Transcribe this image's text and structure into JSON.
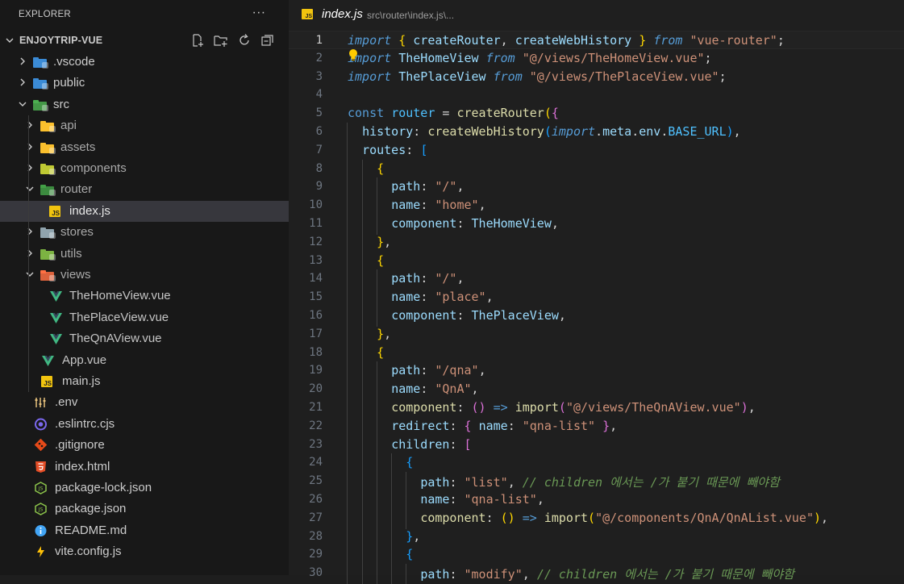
{
  "explorer": {
    "title": "EXPLORER",
    "more_label": "···",
    "project_name": "ENJOYTRIP-VUE",
    "actions": [
      "new-file-icon",
      "new-folder-icon",
      "refresh-icon",
      "collapse-all-icon"
    ],
    "items": [
      {
        "label": ".vscode",
        "kind": "folder",
        "depth": 1,
        "expanded": false,
        "icon": "vscode-folder-icon",
        "color": "#3b8bd6"
      },
      {
        "label": "public",
        "kind": "folder",
        "depth": 1,
        "expanded": false,
        "icon": "public-folder-icon",
        "color": "#3b8bd6"
      },
      {
        "label": "src",
        "kind": "folder",
        "depth": 1,
        "expanded": true,
        "icon": "src-folder-icon",
        "color": "#4caf50"
      },
      {
        "label": "api",
        "kind": "folder",
        "depth": 2,
        "expanded": false,
        "icon": "api-folder-icon",
        "color": "#fbc02d"
      },
      {
        "label": "assets",
        "kind": "folder",
        "depth": 2,
        "expanded": false,
        "icon": "assets-folder-icon",
        "color": "#fbc02d"
      },
      {
        "label": "components",
        "kind": "folder",
        "depth": 2,
        "expanded": false,
        "icon": "components-folder-icon",
        "color": "#c0ca33"
      },
      {
        "label": "router",
        "kind": "folder",
        "depth": 2,
        "expanded": true,
        "icon": "router-folder-icon",
        "color": "#43a047"
      },
      {
        "label": "index.js",
        "kind": "file",
        "depth": 3,
        "icon": "js-file-icon",
        "selected": true
      },
      {
        "label": "stores",
        "kind": "folder",
        "depth": 2,
        "expanded": false,
        "icon": "stores-folder-icon",
        "color": "#90a4ae"
      },
      {
        "label": "utils",
        "kind": "folder",
        "depth": 2,
        "expanded": false,
        "icon": "utils-folder-icon",
        "color": "#7cb342"
      },
      {
        "label": "views",
        "kind": "folder",
        "depth": 2,
        "expanded": true,
        "icon": "views-folder-icon",
        "color": "#ff7043"
      },
      {
        "label": "TheHomeView.vue",
        "kind": "file",
        "depth": 3,
        "icon": "vue-file-icon"
      },
      {
        "label": "ThePlaceView.vue",
        "kind": "file",
        "depth": 3,
        "icon": "vue-file-icon"
      },
      {
        "label": "TheQnAView.vue",
        "kind": "file",
        "depth": 3,
        "icon": "vue-file-icon"
      },
      {
        "label": "App.vue",
        "kind": "file",
        "depth": 2,
        "icon": "vue-file-icon"
      },
      {
        "label": "main.js",
        "kind": "file",
        "depth": 2,
        "icon": "js-file-icon"
      },
      {
        "label": ".env",
        "kind": "file",
        "depth": 1,
        "icon": "env-file-icon"
      },
      {
        "label": ".eslintrc.cjs",
        "kind": "file",
        "depth": 1,
        "icon": "eslint-file-icon"
      },
      {
        "label": ".gitignore",
        "kind": "file",
        "depth": 1,
        "icon": "git-file-icon"
      },
      {
        "label": "index.html",
        "kind": "file",
        "depth": 1,
        "icon": "html-file-icon"
      },
      {
        "label": "package-lock.json",
        "kind": "file",
        "depth": 1,
        "icon": "nodejs-file-icon"
      },
      {
        "label": "package.json",
        "kind": "file",
        "depth": 1,
        "icon": "nodejs-file-icon"
      },
      {
        "label": "README.md",
        "kind": "file",
        "depth": 1,
        "icon": "info-file-icon"
      },
      {
        "label": "vite.config.js",
        "kind": "file",
        "depth": 1,
        "icon": "vite-file-icon"
      }
    ]
  },
  "editor": {
    "file_name": "index.js",
    "file_badge": "JS",
    "file_path": "src\\router\\index.js\\...",
    "current_line": 1,
    "lines": [
      {
        "n": "1",
        "tokens": [
          [
            "kwi",
            "import"
          ],
          [
            "plain",
            " "
          ],
          [
            "p1",
            "{"
          ],
          [
            "plain",
            " "
          ],
          [
            "var",
            "createRouter"
          ],
          [
            "plain",
            ", "
          ],
          [
            "var",
            "createWebHistory"
          ],
          [
            "plain",
            " "
          ],
          [
            "p1",
            "}"
          ],
          [
            "plain",
            " "
          ],
          [
            "kwi",
            "from"
          ],
          [
            "plain",
            " "
          ],
          [
            "str",
            "\"vue-router\""
          ],
          [
            "plain",
            ";"
          ]
        ]
      },
      {
        "n": "2",
        "tokens": [
          [
            "kwi",
            "import"
          ],
          [
            "plain",
            " "
          ],
          [
            "var",
            "TheHomeView"
          ],
          [
            "plain",
            " "
          ],
          [
            "kwi",
            "from"
          ],
          [
            "plain",
            " "
          ],
          [
            "str",
            "\"@/views/TheHomeView.vue\""
          ],
          [
            "plain",
            ";"
          ]
        ]
      },
      {
        "n": "3",
        "tokens": [
          [
            "kwi",
            "import"
          ],
          [
            "plain",
            " "
          ],
          [
            "var",
            "ThePlaceView"
          ],
          [
            "plain",
            " "
          ],
          [
            "kwi",
            "from"
          ],
          [
            "plain",
            " "
          ],
          [
            "str",
            "\"@/views/ThePlaceView.vue\""
          ],
          [
            "plain",
            ";"
          ]
        ]
      },
      {
        "n": "4",
        "tokens": []
      },
      {
        "n": "5",
        "tokens": [
          [
            "kw",
            "const"
          ],
          [
            "plain",
            " "
          ],
          [
            "const",
            "router"
          ],
          [
            "plain",
            " = "
          ],
          [
            "fn",
            "createRouter"
          ],
          [
            "p1",
            "("
          ],
          [
            "p2",
            "{"
          ]
        ]
      },
      {
        "n": "6",
        "tokens": [
          [
            "plain",
            "  "
          ],
          [
            "def",
            "history"
          ],
          [
            "plain",
            ": "
          ],
          [
            "fn",
            "createWebHistory"
          ],
          [
            "p3",
            "("
          ],
          [
            "kwi",
            "import"
          ],
          [
            "plain",
            "."
          ],
          [
            "var",
            "meta"
          ],
          [
            "plain",
            "."
          ],
          [
            "var",
            "env"
          ],
          [
            "plain",
            "."
          ],
          [
            "const",
            "BASE_URL"
          ],
          [
            "p3",
            ")"
          ],
          [
            "plain",
            ","
          ]
        ]
      },
      {
        "n": "7",
        "tokens": [
          [
            "plain",
            "  "
          ],
          [
            "def",
            "routes"
          ],
          [
            "plain",
            ": "
          ],
          [
            "p3",
            "["
          ]
        ]
      },
      {
        "n": "8",
        "tokens": [
          [
            "plain",
            "    "
          ],
          [
            "p1",
            "{"
          ]
        ]
      },
      {
        "n": "9",
        "tokens": [
          [
            "plain",
            "      "
          ],
          [
            "def",
            "path"
          ],
          [
            "plain",
            ": "
          ],
          [
            "str",
            "\"/\""
          ],
          [
            "plain",
            ","
          ]
        ]
      },
      {
        "n": "10",
        "tokens": [
          [
            "plain",
            "      "
          ],
          [
            "def",
            "name"
          ],
          [
            "plain",
            ": "
          ],
          [
            "str",
            "\"home\""
          ],
          [
            "plain",
            ","
          ]
        ]
      },
      {
        "n": "11",
        "tokens": [
          [
            "plain",
            "      "
          ],
          [
            "def",
            "component"
          ],
          [
            "plain",
            ": "
          ],
          [
            "var",
            "TheHomeView"
          ],
          [
            "plain",
            ","
          ]
        ]
      },
      {
        "n": "12",
        "tokens": [
          [
            "plain",
            "    "
          ],
          [
            "p1",
            "}"
          ],
          [
            "plain",
            ","
          ]
        ]
      },
      {
        "n": "13",
        "tokens": [
          [
            "plain",
            "    "
          ],
          [
            "p1",
            "{"
          ]
        ]
      },
      {
        "n": "14",
        "tokens": [
          [
            "plain",
            "      "
          ],
          [
            "def",
            "path"
          ],
          [
            "plain",
            ": "
          ],
          [
            "str",
            "\"/\""
          ],
          [
            "plain",
            ","
          ]
        ]
      },
      {
        "n": "15",
        "tokens": [
          [
            "plain",
            "      "
          ],
          [
            "def",
            "name"
          ],
          [
            "plain",
            ": "
          ],
          [
            "str",
            "\"place\""
          ],
          [
            "plain",
            ","
          ]
        ]
      },
      {
        "n": "16",
        "tokens": [
          [
            "plain",
            "      "
          ],
          [
            "def",
            "component"
          ],
          [
            "plain",
            ": "
          ],
          [
            "var",
            "ThePlaceView"
          ],
          [
            "plain",
            ","
          ]
        ]
      },
      {
        "n": "17",
        "tokens": [
          [
            "plain",
            "    "
          ],
          [
            "p1",
            "}"
          ],
          [
            "plain",
            ","
          ]
        ]
      },
      {
        "n": "18",
        "tokens": [
          [
            "plain",
            "    "
          ],
          [
            "p1",
            "{"
          ]
        ]
      },
      {
        "n": "19",
        "tokens": [
          [
            "plain",
            "      "
          ],
          [
            "def",
            "path"
          ],
          [
            "plain",
            ": "
          ],
          [
            "str",
            "\"/qna\""
          ],
          [
            "plain",
            ","
          ]
        ]
      },
      {
        "n": "20",
        "tokens": [
          [
            "plain",
            "      "
          ],
          [
            "def",
            "name"
          ],
          [
            "plain",
            ": "
          ],
          [
            "str",
            "\"QnA\""
          ],
          [
            "plain",
            ","
          ]
        ]
      },
      {
        "n": "21",
        "tokens": [
          [
            "plain",
            "      "
          ],
          [
            "fn",
            "component"
          ],
          [
            "plain",
            ": "
          ],
          [
            "p2",
            "()"
          ],
          [
            "plain",
            " "
          ],
          [
            "kw",
            "=>"
          ],
          [
            "plain",
            " "
          ],
          [
            "fn",
            "import"
          ],
          [
            "p2",
            "("
          ],
          [
            "str",
            "\"@/views/TheQnAView.vue\""
          ],
          [
            "p2",
            ")"
          ],
          [
            "plain",
            ","
          ]
        ]
      },
      {
        "n": "22",
        "tokens": [
          [
            "plain",
            "      "
          ],
          [
            "def",
            "redirect"
          ],
          [
            "plain",
            ": "
          ],
          [
            "p2",
            "{"
          ],
          [
            "plain",
            " "
          ],
          [
            "def",
            "name"
          ],
          [
            "plain",
            ": "
          ],
          [
            "str",
            "\"qna-list\""
          ],
          [
            "plain",
            " "
          ],
          [
            "p2",
            "}"
          ],
          [
            "plain",
            ","
          ]
        ]
      },
      {
        "n": "23",
        "tokens": [
          [
            "plain",
            "      "
          ],
          [
            "def",
            "children"
          ],
          [
            "plain",
            ": "
          ],
          [
            "p2",
            "["
          ]
        ]
      },
      {
        "n": "24",
        "tokens": [
          [
            "plain",
            "        "
          ],
          [
            "p3",
            "{"
          ]
        ]
      },
      {
        "n": "25",
        "tokens": [
          [
            "plain",
            "          "
          ],
          [
            "def",
            "path"
          ],
          [
            "plain",
            ": "
          ],
          [
            "str",
            "\"list\""
          ],
          [
            "plain",
            ", "
          ],
          [
            "cm",
            "// children 에서는 /가 붙기 때문에 빼야함"
          ]
        ]
      },
      {
        "n": "26",
        "tokens": [
          [
            "plain",
            "          "
          ],
          [
            "def",
            "name"
          ],
          [
            "plain",
            ": "
          ],
          [
            "str",
            "\"qna-list\""
          ],
          [
            "plain",
            ","
          ]
        ]
      },
      {
        "n": "27",
        "tokens": [
          [
            "plain",
            "          "
          ],
          [
            "fn",
            "component"
          ],
          [
            "plain",
            ": "
          ],
          [
            "p1",
            "()"
          ],
          [
            "plain",
            " "
          ],
          [
            "kw",
            "=>"
          ],
          [
            "plain",
            " "
          ],
          [
            "fn",
            "import"
          ],
          [
            "p1",
            "("
          ],
          [
            "str",
            "\"@/components/QnA/QnAList.vue\""
          ],
          [
            "p1",
            ")"
          ],
          [
            "plain",
            ","
          ]
        ]
      },
      {
        "n": "28",
        "tokens": [
          [
            "plain",
            "        "
          ],
          [
            "p3",
            "}"
          ],
          [
            "plain",
            ","
          ]
        ]
      },
      {
        "n": "29",
        "tokens": [
          [
            "plain",
            "        "
          ],
          [
            "p3",
            "{"
          ]
        ]
      },
      {
        "n": "30",
        "tokens": [
          [
            "plain",
            "          "
          ],
          [
            "def",
            "path"
          ],
          [
            "plain",
            ": "
          ],
          [
            "str",
            "\"modify\""
          ],
          [
            "plain",
            ", "
          ],
          [
            "cm",
            "// children 에서는 /가 붙기 때문에 빼야함"
          ]
        ]
      }
    ]
  },
  "colors": {
    "sidebar_bg": "#181818",
    "editor_bg": "#1f1f1f",
    "selection_bg": "#37373d"
  }
}
